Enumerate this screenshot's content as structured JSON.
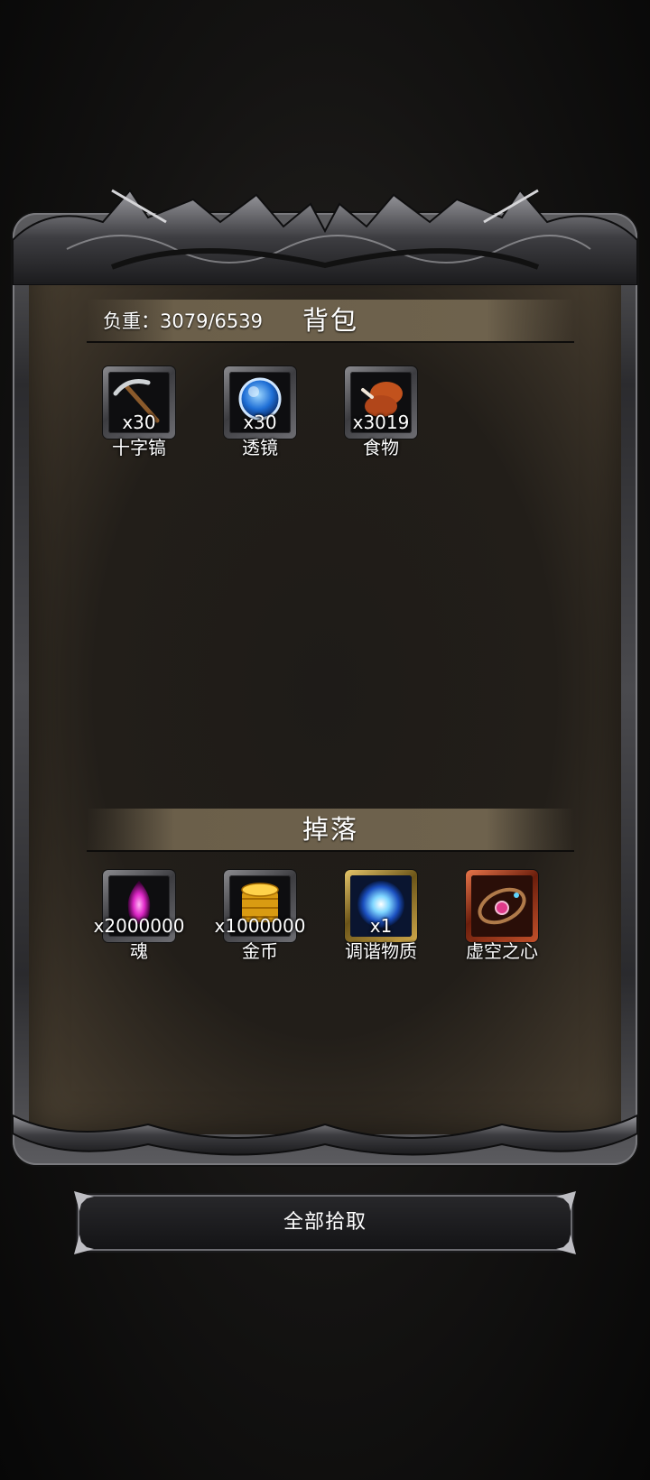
{
  "inventory": {
    "title": "背包",
    "load_text": "负重：3079/6539",
    "items": [
      {
        "icon": "pickaxe-icon",
        "qty": "x30",
        "name": "十字镐"
      },
      {
        "icon": "lens-icon",
        "qty": "x30",
        "name": "透镜"
      },
      {
        "icon": "food-icon",
        "qty": "x3019",
        "name": "食物"
      }
    ]
  },
  "drops": {
    "title": "掉落",
    "items": [
      {
        "icon": "soul-icon",
        "qty": "x2000000",
        "name": "魂"
      },
      {
        "icon": "gold-coin-icon",
        "qty": "x1000000",
        "name": "金币"
      },
      {
        "icon": "harmony-matter-icon",
        "qty": "x1",
        "name": "调谐物质"
      },
      {
        "icon": "void-heart-icon",
        "qty": "",
        "name": "虚空之心"
      }
    ]
  },
  "actions": {
    "pickup_all_label": "全部拾取"
  },
  "colors": {
    "background": "#141312",
    "panel": "#221e19",
    "header_band": "#6b5f4a",
    "frame_metal": "#4a4a4e",
    "text": "#ffffff"
  }
}
